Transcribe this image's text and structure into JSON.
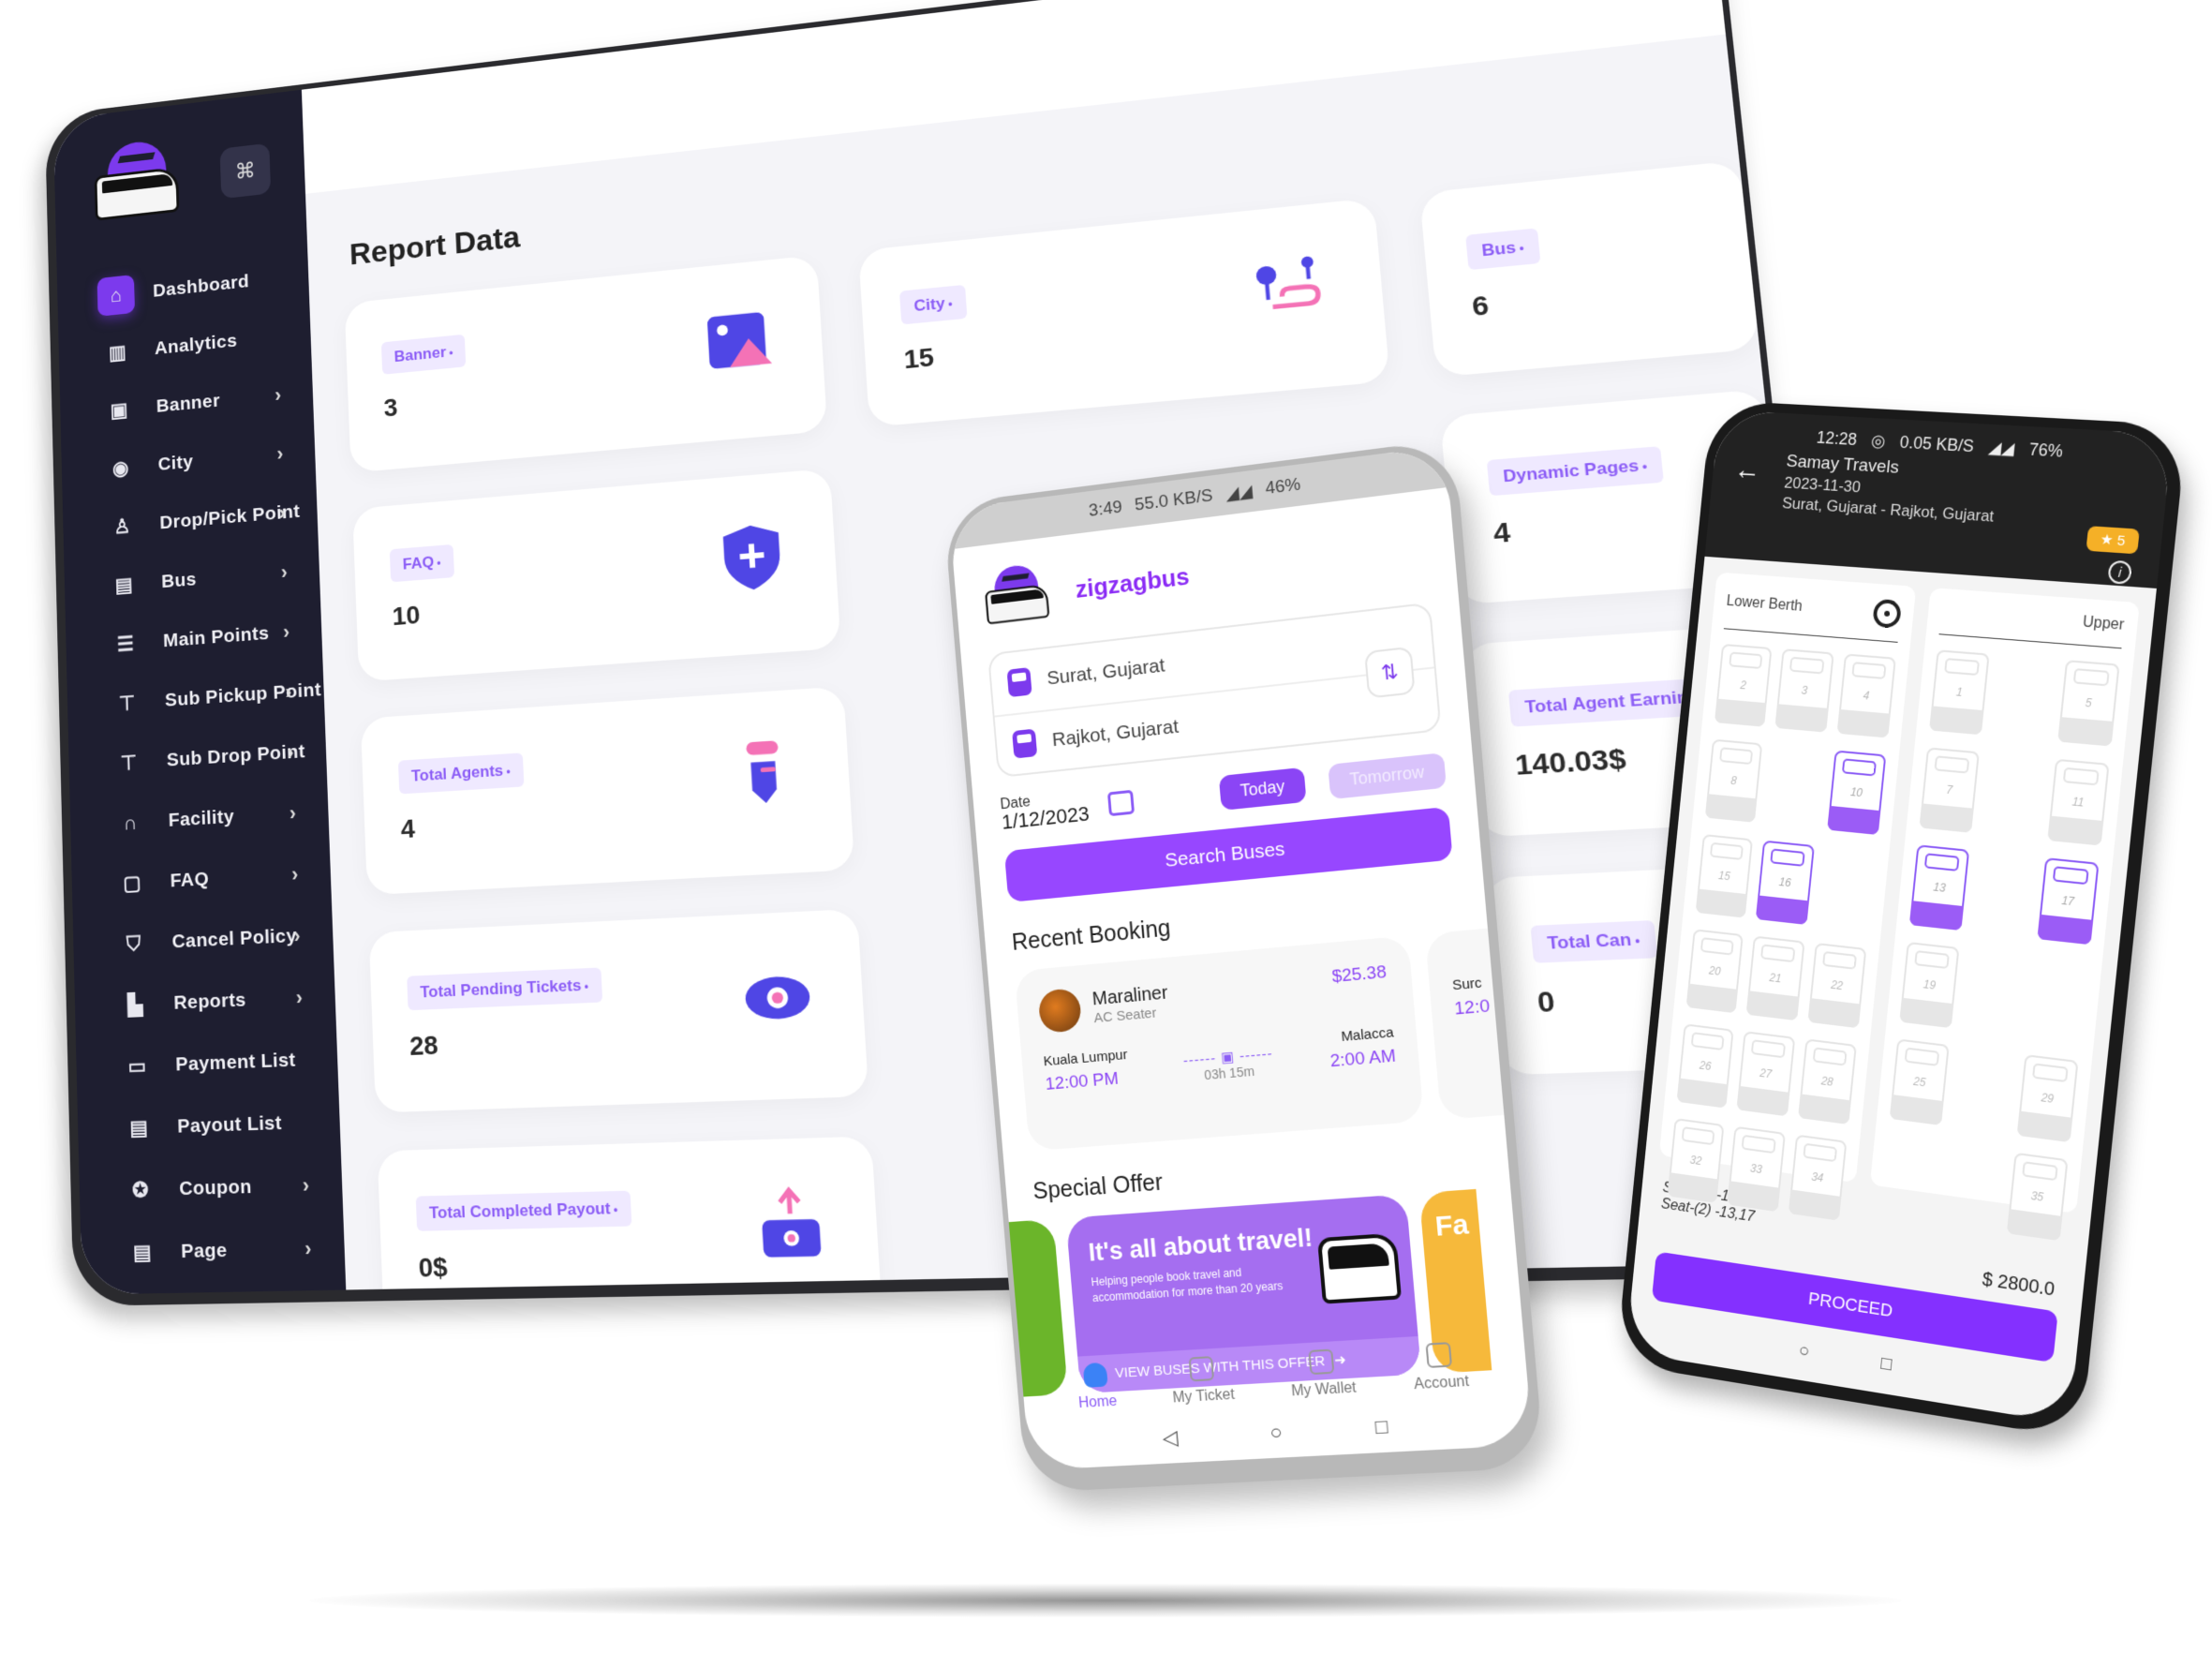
{
  "dashboard": {
    "grid_button_icon": "grid-icon",
    "page_title": "Report Data",
    "sidebar": {
      "items": [
        {
          "label": "Dashboard",
          "icon": "home-icon",
          "glyph": "⌂",
          "active": true,
          "has_chevron": false
        },
        {
          "label": "Analytics",
          "icon": "analytics-icon",
          "glyph": "▥",
          "active": false,
          "has_chevron": false
        },
        {
          "label": "Banner",
          "icon": "image-icon",
          "glyph": "▣",
          "active": false,
          "has_chevron": true
        },
        {
          "label": "City",
          "icon": "location-pin-icon",
          "glyph": "◉",
          "active": false,
          "has_chevron": true
        },
        {
          "label": "Drop/Pick Point",
          "icon": "person-pin-icon",
          "glyph": "♙",
          "active": false,
          "has_chevron": true
        },
        {
          "label": "Bus",
          "icon": "bus-icon",
          "glyph": "▤",
          "active": false,
          "has_chevron": true
        },
        {
          "label": "Main Points",
          "icon": "signpost-icon",
          "glyph": "☰",
          "active": false,
          "has_chevron": true
        },
        {
          "label": "Sub Pickup Point",
          "icon": "signpost-icon",
          "glyph": "⊤",
          "active": false,
          "has_chevron": true
        },
        {
          "label": "Sub Drop Point",
          "icon": "signpost-icon",
          "glyph": "⊤",
          "active": false,
          "has_chevron": true
        },
        {
          "label": "Facility",
          "icon": "headphones-icon",
          "glyph": "∩",
          "active": false,
          "has_chevron": true
        },
        {
          "label": "FAQ",
          "icon": "chat-icon",
          "glyph": "▢",
          "active": false,
          "has_chevron": true
        },
        {
          "label": "Cancel Policy",
          "icon": "shield-icon",
          "glyph": "⛉",
          "active": false,
          "has_chevron": true
        },
        {
          "label": "Reports",
          "icon": "report-icon",
          "glyph": "▙",
          "active": false,
          "has_chevron": true
        },
        {
          "label": "Payment List",
          "icon": "credit-card-icon",
          "glyph": "▭",
          "active": false,
          "has_chevron": false
        },
        {
          "label": "Payout List",
          "icon": "payout-icon",
          "glyph": "▤",
          "active": false,
          "has_chevron": false
        },
        {
          "label": "Coupon",
          "icon": "coupon-icon",
          "glyph": "✪",
          "active": false,
          "has_chevron": true
        },
        {
          "label": "Page",
          "icon": "page-icon",
          "glyph": "▤",
          "active": false,
          "has_chevron": true
        }
      ],
      "chevron_glyph": "›"
    },
    "cards": [
      {
        "label": "Banner",
        "value": "3",
        "icon": "image-icon"
      },
      {
        "label": "City",
        "value": "15",
        "icon": "route-icon"
      },
      {
        "label": "Bus",
        "value": "6",
        "icon": ""
      },
      {
        "label": "FAQ",
        "value": "10",
        "icon": "shield-plus-icon"
      },
      {
        "label": "",
        "value": "",
        "icon": ""
      },
      {
        "label": "Dynamic Pages",
        "value": "4",
        "icon": ""
      },
      {
        "label": "Total Agents",
        "value": "4",
        "icon": "agent-tie-icon"
      },
      {
        "label": "",
        "value": "",
        "icon": ""
      },
      {
        "label": "Total Agent Earning",
        "value": "140.03$",
        "icon": ""
      },
      {
        "label": "Total Pending Tickets",
        "value": "28",
        "icon": "eye-icon"
      },
      {
        "label": "",
        "value": "",
        "icon": ""
      },
      {
        "label": "Total Can",
        "value": "0",
        "icon": ""
      },
      {
        "label": "Total Completed Payout",
        "value": "0$",
        "icon": "payout-upload-icon"
      }
    ]
  },
  "home_phone": {
    "status_bar": {
      "time": "3:49",
      "speed": "55.0 KB/S",
      "battery": "46%"
    },
    "brand": "zigzagbus",
    "from": "Surat, Gujarat",
    "to": "Rajkot, Gujarat",
    "swap_glyph": "⇅",
    "date_label": "Date",
    "date_value": "1/12/2023",
    "today_label": "Today",
    "tomorrow_label": "Tomorrow",
    "search_label": "Search Buses",
    "recent_title": "Recent Booking",
    "booking": {
      "operator": "Maraliner",
      "type": "AC Seater",
      "price": "$25.38",
      "from_city": "Kuala Lumpur",
      "from_time": "12:00 PM",
      "to_city": "Malacca",
      "to_time": "2:00 AM",
      "duration": "03h 15m",
      "dash": "------ ▣ ------"
    },
    "booking_peek": {
      "from_city": "Surc",
      "from_time": "12:0"
    },
    "offer_title": "Special Offer",
    "offer": {
      "headline": "It's all about travel!",
      "sub": "Helping people book travel and accommodation for more than 20 years",
      "cta": "VIEW BUSES WITH THIS OFFER",
      "cta_glyph": "➜"
    },
    "offer_peek_text": "Fa",
    "tabs": [
      {
        "label": "Home",
        "icon": "home-icon",
        "active": true
      },
      {
        "label": "My Ticket",
        "icon": "ticket-icon",
        "active": false
      },
      {
        "label": "My Wallet",
        "icon": "wallet-icon",
        "active": false
      },
      {
        "label": "Account",
        "icon": "user-icon",
        "active": false
      }
    ],
    "nav": [
      "◁",
      "○",
      "□"
    ]
  },
  "seat_phone": {
    "status_bar": {
      "time": "12:28",
      "speed": "0.05 KB/S",
      "battery": "76%"
    },
    "back_glyph": "←",
    "operator": "Samay Travels",
    "date": "2023-11-30",
    "route": "Surat, Gujarat - Rajkot, Gujarat",
    "rating": "★ 5",
    "info_glyph": "i",
    "lower_title": "Lower Berth",
    "upper_title": "Upper",
    "lower_seats": [
      {
        "n": "2",
        "s": false
      },
      {
        "n": "3",
        "s": false
      },
      {
        "n": "4",
        "s": false
      },
      {
        "n": "8",
        "s": false
      },
      {
        "n": "",
        "s": false
      },
      {
        "n": "10",
        "s": true
      },
      {
        "n": "15",
        "s": false
      },
      {
        "n": "16",
        "s": true
      },
      {
        "n": "",
        "s": false
      },
      {
        "n": "20",
        "s": false
      },
      {
        "n": "21",
        "s": false
      },
      {
        "n": "22",
        "s": false
      },
      {
        "n": "26",
        "s": false
      },
      {
        "n": "27",
        "s": false
      },
      {
        "n": "28",
        "s": false
      },
      {
        "n": "32",
        "s": false
      },
      {
        "n": "33",
        "s": false
      },
      {
        "n": "34",
        "s": false
      }
    ],
    "upper_seats": [
      {
        "n": "1",
        "s": false
      },
      {
        "n": "",
        "s": false
      },
      {
        "n": "5",
        "s": false
      },
      {
        "n": "7",
        "s": false
      },
      {
        "n": "",
        "s": false
      },
      {
        "n": "11",
        "s": false
      },
      {
        "n": "13",
        "s": true
      },
      {
        "n": "",
        "s": false
      },
      {
        "n": "17",
        "s": true
      },
      {
        "n": "19",
        "s": false
      },
      {
        "n": "",
        "s": false
      },
      {
        "n": "",
        "s": false
      },
      {
        "n": "25",
        "s": false
      },
      {
        "n": "",
        "s": false
      },
      {
        "n": "29",
        "s": false
      },
      {
        "n": "",
        "s": false
      },
      {
        "n": "",
        "s": false
      },
      {
        "n": "35",
        "s": false
      }
    ],
    "summary_lower": "Seat-(2) -10,16",
    "summary_upper": "Seat-(2) -13,17",
    "total": "$ 2800.0",
    "proceed_label": "PROCEED",
    "nav": [
      "○",
      "□"
    ]
  },
  "colors": {
    "accent": "#8b5cf6",
    "accent_strong": "#7c3aed",
    "sidebar_bg": "#1e1e30",
    "pink": "#f472b6",
    "indigo": "#4f46e5",
    "rating": "#f5b027"
  }
}
